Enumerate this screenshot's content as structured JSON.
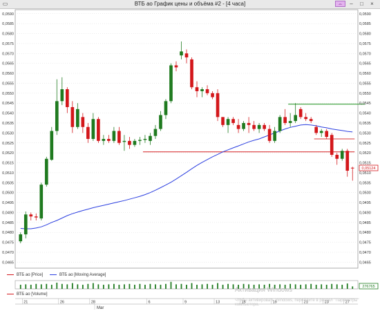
{
  "window": {
    "title": "ВТБ ао График цены и объёма #2 - [4 часа]",
    "lock_label": "⇔"
  },
  "legend": {
    "price": "ВТБ ао [Price]",
    "ma": "ВТБ ао [Moving Average]",
    "volume": "ВТБ ао [Volume]"
  },
  "price_axis": {
    "ticks": [
      "0,0590",
      "0,0585",
      "0,0580",
      "0,0575",
      "0,0570",
      "0,0565",
      "0,0560",
      "0,0555",
      "0,0550",
      "0,0545",
      "0,0540",
      "0,0535",
      "0,0530",
      "0,0525",
      "0,0520",
      "0,0515",
      "0,0510",
      "0,0505",
      "0,0500",
      "0,0495",
      "0,0490",
      "0,0485",
      "0,0480",
      "0,0475",
      "0,0470",
      "0,0465"
    ],
    "last_price_label": "0,05124"
  },
  "volume_axis": {
    "last_label": "276765"
  },
  "time_axis": {
    "day_labels": [
      "21",
      "26",
      "28",
      "6",
      "9",
      "13",
      "15",
      "19",
      "21",
      "23",
      "27"
    ],
    "month_label": "Mar"
  },
  "watermark": {
    "line1": "Активация Windows",
    "line2": "Чтобы активировать Windows, перейдите в раздел \"Параметры\" компьютера."
  },
  "colors": {
    "up": "#1f7a1f",
    "down": "#d3171b",
    "ma": "#2a3ee0",
    "support": "#d9383a",
    "resistance": "#2f9a2f",
    "grid": "#d9d9d9"
  },
  "chart_data": {
    "type": "candlestick",
    "y_axis_range": [
      0.0462,
      0.0592
    ],
    "y_scale": "linear",
    "grid": true,
    "candles": [
      {
        "o": 0.04755,
        "h": 0.048,
        "l": 0.04745,
        "c": 0.0479
      },
      {
        "o": 0.0479,
        "h": 0.04905,
        "l": 0.0477,
        "c": 0.0489
      },
      {
        "o": 0.0489,
        "h": 0.049,
        "l": 0.0486,
        "c": 0.0488
      },
      {
        "o": 0.0488,
        "h": 0.04895,
        "l": 0.0486,
        "c": 0.04875
      },
      {
        "o": 0.0487,
        "h": 0.0505,
        "l": 0.0486,
        "c": 0.0504
      },
      {
        "o": 0.0504,
        "h": 0.0518,
        "l": 0.0503,
        "c": 0.0517
      },
      {
        "o": 0.05165,
        "h": 0.0533,
        "l": 0.0516,
        "c": 0.0531
      },
      {
        "o": 0.0531,
        "h": 0.0557,
        "l": 0.0529,
        "c": 0.0546
      },
      {
        "o": 0.0546,
        "h": 0.0558,
        "l": 0.0544,
        "c": 0.0552
      },
      {
        "o": 0.0552,
        "h": 0.0553,
        "l": 0.054,
        "c": 0.0543
      },
      {
        "o": 0.0543,
        "h": 0.0546,
        "l": 0.053,
        "c": 0.0533
      },
      {
        "o": 0.0533,
        "h": 0.0545,
        "l": 0.0532,
        "c": 0.0542
      },
      {
        "o": 0.0538,
        "h": 0.054,
        "l": 0.053,
        "c": 0.0533
      },
      {
        "o": 0.0533,
        "h": 0.0535,
        "l": 0.0525,
        "c": 0.0527
      },
      {
        "o": 0.0527,
        "h": 0.054,
        "l": 0.0526,
        "c": 0.0537
      },
      {
        "o": 0.0537,
        "h": 0.0538,
        "l": 0.0525,
        "c": 0.0526
      },
      {
        "o": 0.0526,
        "h": 0.0529,
        "l": 0.0524,
        "c": 0.0527
      },
      {
        "o": 0.0527,
        "h": 0.0529,
        "l": 0.0525,
        "c": 0.0526
      },
      {
        "o": 0.0526,
        "h": 0.0533,
        "l": 0.0525,
        "c": 0.0531
      },
      {
        "o": 0.0531,
        "h": 0.0533,
        "l": 0.0524,
        "c": 0.0525
      },
      {
        "o": 0.05255,
        "h": 0.0529,
        "l": 0.0521,
        "c": 0.0526
      },
      {
        "o": 0.0526,
        "h": 0.0528,
        "l": 0.0522,
        "c": 0.0524
      },
      {
        "o": 0.0524,
        "h": 0.0527,
        "l": 0.0523,
        "c": 0.0526
      },
      {
        "o": 0.0526,
        "h": 0.0528,
        "l": 0.0524,
        "c": 0.05265
      },
      {
        "o": 0.05265,
        "h": 0.0529,
        "l": 0.0525,
        "c": 0.0527
      },
      {
        "o": 0.0526,
        "h": 0.053,
        "l": 0.0524,
        "c": 0.05285
      },
      {
        "o": 0.05285,
        "h": 0.0534,
        "l": 0.0527,
        "c": 0.0532
      },
      {
        "o": 0.0532,
        "h": 0.0541,
        "l": 0.0531,
        "c": 0.0539
      },
      {
        "o": 0.0539,
        "h": 0.0547,
        "l": 0.0537,
        "c": 0.0546
      },
      {
        "o": 0.0546,
        "h": 0.0565,
        "l": 0.0545,
        "c": 0.0564
      },
      {
        "o": 0.0564,
        "h": 0.0566,
        "l": 0.0561,
        "c": 0.0563
      },
      {
        "o": 0.0569,
        "h": 0.0576,
        "l": 0.0567,
        "c": 0.0571
      },
      {
        "o": 0.057,
        "h": 0.0572,
        "l": 0.0565,
        "c": 0.0568
      },
      {
        "o": 0.0567,
        "h": 0.0568,
        "l": 0.0552,
        "c": 0.0553
      },
      {
        "o": 0.0553,
        "h": 0.0556,
        "l": 0.0548,
        "c": 0.0551
      },
      {
        "o": 0.0551,
        "h": 0.0553,
        "l": 0.0548,
        "c": 0.0552
      },
      {
        "o": 0.0552,
        "h": 0.0554,
        "l": 0.0549,
        "c": 0.055
      },
      {
        "o": 0.055,
        "h": 0.0551,
        "l": 0.0547,
        "c": 0.0548
      },
      {
        "o": 0.055,
        "h": 0.0552,
        "l": 0.0536,
        "c": 0.0538
      },
      {
        "o": 0.0538,
        "h": 0.0538,
        "l": 0.0533,
        "c": 0.0534
      },
      {
        "o": 0.0534,
        "h": 0.0538,
        "l": 0.053,
        "c": 0.0537
      },
      {
        "o": 0.0537,
        "h": 0.0538,
        "l": 0.0534,
        "c": 0.0535
      },
      {
        "o": 0.0534,
        "h": 0.0537,
        "l": 0.053,
        "c": 0.0532
      },
      {
        "o": 0.0532,
        "h": 0.0536,
        "l": 0.0531,
        "c": 0.0535
      },
      {
        "o": 0.0535,
        "h": 0.0538,
        "l": 0.053,
        "c": 0.0534
      },
      {
        "o": 0.0534,
        "h": 0.0536,
        "l": 0.0531,
        "c": 0.0532
      },
      {
        "o": 0.0532,
        "h": 0.0535,
        "l": 0.053,
        "c": 0.0534
      },
      {
        "o": 0.0534,
        "h": 0.0535,
        "l": 0.0531,
        "c": 0.0532
      },
      {
        "o": 0.0532,
        "h": 0.0534,
        "l": 0.0525,
        "c": 0.0526
      },
      {
        "o": 0.0526,
        "h": 0.0533,
        "l": 0.0525,
        "c": 0.0531
      },
      {
        "o": 0.0531,
        "h": 0.0539,
        "l": 0.053,
        "c": 0.0538
      },
      {
        "o": 0.0538,
        "h": 0.0542,
        "l": 0.0534,
        "c": 0.0535
      },
      {
        "o": 0.0535,
        "h": 0.054,
        "l": 0.0533,
        "c": 0.0536
      },
      {
        "o": 0.0536,
        "h": 0.0545,
        "l": 0.0535,
        "c": 0.0539
      },
      {
        "o": 0.0542,
        "h": 0.0543,
        "l": 0.0537,
        "c": 0.0538
      },
      {
        "o": 0.0538,
        "h": 0.054,
        "l": 0.0536,
        "c": 0.0537
      },
      {
        "o": 0.0537,
        "h": 0.0538,
        "l": 0.0535,
        "c": 0.0536
      },
      {
        "o": 0.0533,
        "h": 0.0534,
        "l": 0.0529,
        "c": 0.053
      },
      {
        "o": 0.053,
        "h": 0.0532,
        "l": 0.0528,
        "c": 0.0531
      },
      {
        "o": 0.0531,
        "h": 0.0532,
        "l": 0.0527,
        "c": 0.0528
      },
      {
        "o": 0.0529,
        "h": 0.053,
        "l": 0.0518,
        "c": 0.0519
      },
      {
        "o": 0.0519,
        "h": 0.052,
        "l": 0.0514,
        "c": 0.0517
      },
      {
        "o": 0.0517,
        "h": 0.0522,
        "l": 0.0516,
        "c": 0.0521
      },
      {
        "o": 0.0521,
        "h": 0.0522,
        "l": 0.0508,
        "c": 0.0511
      },
      {
        "o": 0.05125,
        "h": 0.0513,
        "l": 0.0506,
        "c": 0.05124
      }
    ],
    "moving_average": [
      0.0482,
      0.04818,
      0.04818,
      0.04822,
      0.04828,
      0.04838,
      0.0485,
      0.0486,
      0.04872,
      0.04884,
      0.04894,
      0.04902,
      0.0491,
      0.04917,
      0.04924,
      0.0493,
      0.04936,
      0.04942,
      0.04948,
      0.04954,
      0.0496,
      0.04967,
      0.04974,
      0.04981,
      0.0499,
      0.05,
      0.05012,
      0.05025,
      0.05038,
      0.05052,
      0.05068,
      0.05085,
      0.05102,
      0.0512,
      0.05137,
      0.05152,
      0.05166,
      0.0518,
      0.05192,
      0.05205,
      0.05215,
      0.05225,
      0.05235,
      0.05245,
      0.05255,
      0.05263,
      0.0527,
      0.0528,
      0.0529,
      0.053,
      0.0531,
      0.0532,
      0.05328,
      0.05334,
      0.0534,
      0.05342,
      0.0534,
      0.05336,
      0.0533,
      0.05326,
      0.0532,
      0.05316,
      0.05312,
      0.05308,
      0.05305
    ],
    "horizontal_levels": [
      {
        "role": "resistance",
        "value": 0.05445,
        "from_candle": 52,
        "to_candle": 66
      },
      {
        "role": "support",
        "value": 0.0527,
        "from_candle": 57,
        "to_candle": 64
      },
      {
        "role": "support",
        "value": 0.05205,
        "from_candle": 24,
        "to_candle": 64
      }
    ],
    "volume": [
      0.5,
      0.55,
      0.5,
      0.6,
      0.55,
      0.6,
      0.5,
      0.75,
      0.6,
      0.55,
      0.7,
      0.55,
      0.5,
      0.6,
      0.7,
      0.55,
      0.5,
      0.55,
      0.6,
      0.5,
      0.55,
      0.6,
      0.5,
      0.6,
      0.5,
      0.6,
      0.55,
      0.5,
      0.6,
      0.85,
      0.55,
      0.6,
      0.5,
      0.7,
      0.5,
      0.55,
      0.6,
      0.5,
      0.7,
      0.5,
      0.6,
      0.55,
      0.5,
      0.6,
      0.55,
      0.5,
      0.55,
      0.5,
      0.6,
      0.5,
      0.55,
      0.5,
      0.6,
      0.55,
      0.5,
      0.55,
      0.6,
      0.5,
      0.55,
      0.5,
      0.6,
      0.55,
      0.5,
      0.65,
      0.3
    ]
  }
}
